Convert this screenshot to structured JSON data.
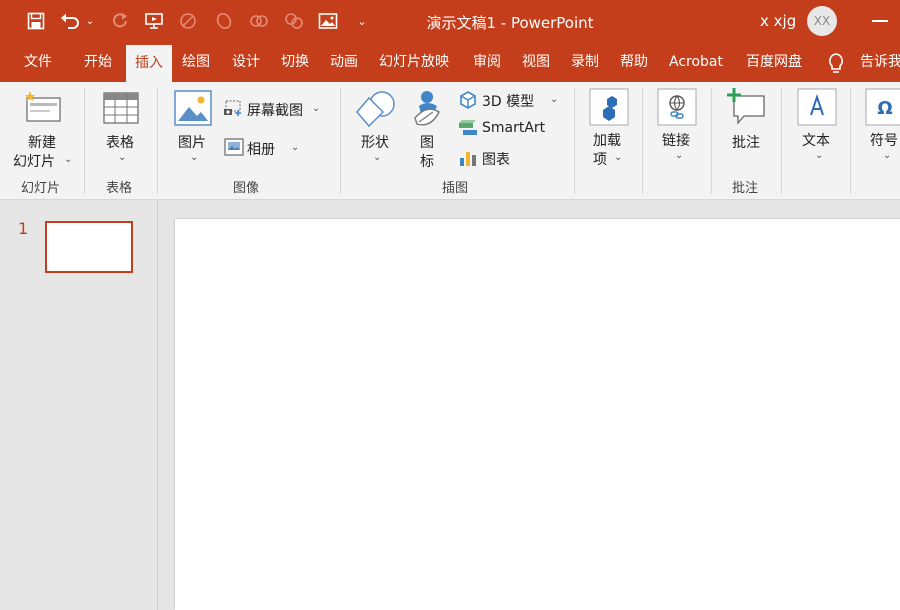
{
  "title_bar": {
    "document_title": "演示文稿1  -  PowerPoint",
    "user_name": "x xjg",
    "avatar_initials": "XX",
    "quick_access_icons": [
      "save-icon",
      "undo-icon",
      "chevron-down-icon",
      "redo-icon",
      "present-icon",
      "shape-icon",
      "circle-icon",
      "link-icon",
      "group-icon",
      "picture-icon",
      "customize-icon"
    ]
  },
  "tabs": [
    "文件",
    "开始",
    "插入",
    "绘图",
    "设计",
    "切换",
    "动画",
    "幻灯片放映",
    "审阅",
    "视图",
    "录制",
    "帮助",
    "Acrobat",
    "百度网盘",
    "告诉我"
  ],
  "active_tab": "插入",
  "ribbon": {
    "new_slide": {
      "line1": "新建",
      "line2": "幻灯片"
    },
    "table": "表格",
    "picture": "图片",
    "screenshot": "屏幕截图",
    "album": "相册",
    "shapes": "形状",
    "icons": {
      "line1": "图",
      "line2": "标"
    },
    "model_3d": "3D 模型",
    "smartart": "SmartArt",
    "chart": "图表",
    "addins": {
      "line1": "加载",
      "line2": "项"
    },
    "link": "链接",
    "comment": "批注",
    "text": "文本",
    "symbol": "符号",
    "groups": {
      "slides": "幻灯片",
      "tables": "表格",
      "images": "图像",
      "illustrations": "插图",
      "comments": "批注"
    }
  },
  "slides": {
    "current_number": "1"
  },
  "colors": {
    "accent": "#c43e1c",
    "ribbon_bg": "#f3f3f3",
    "workspace_bg": "#e6e6e6"
  }
}
